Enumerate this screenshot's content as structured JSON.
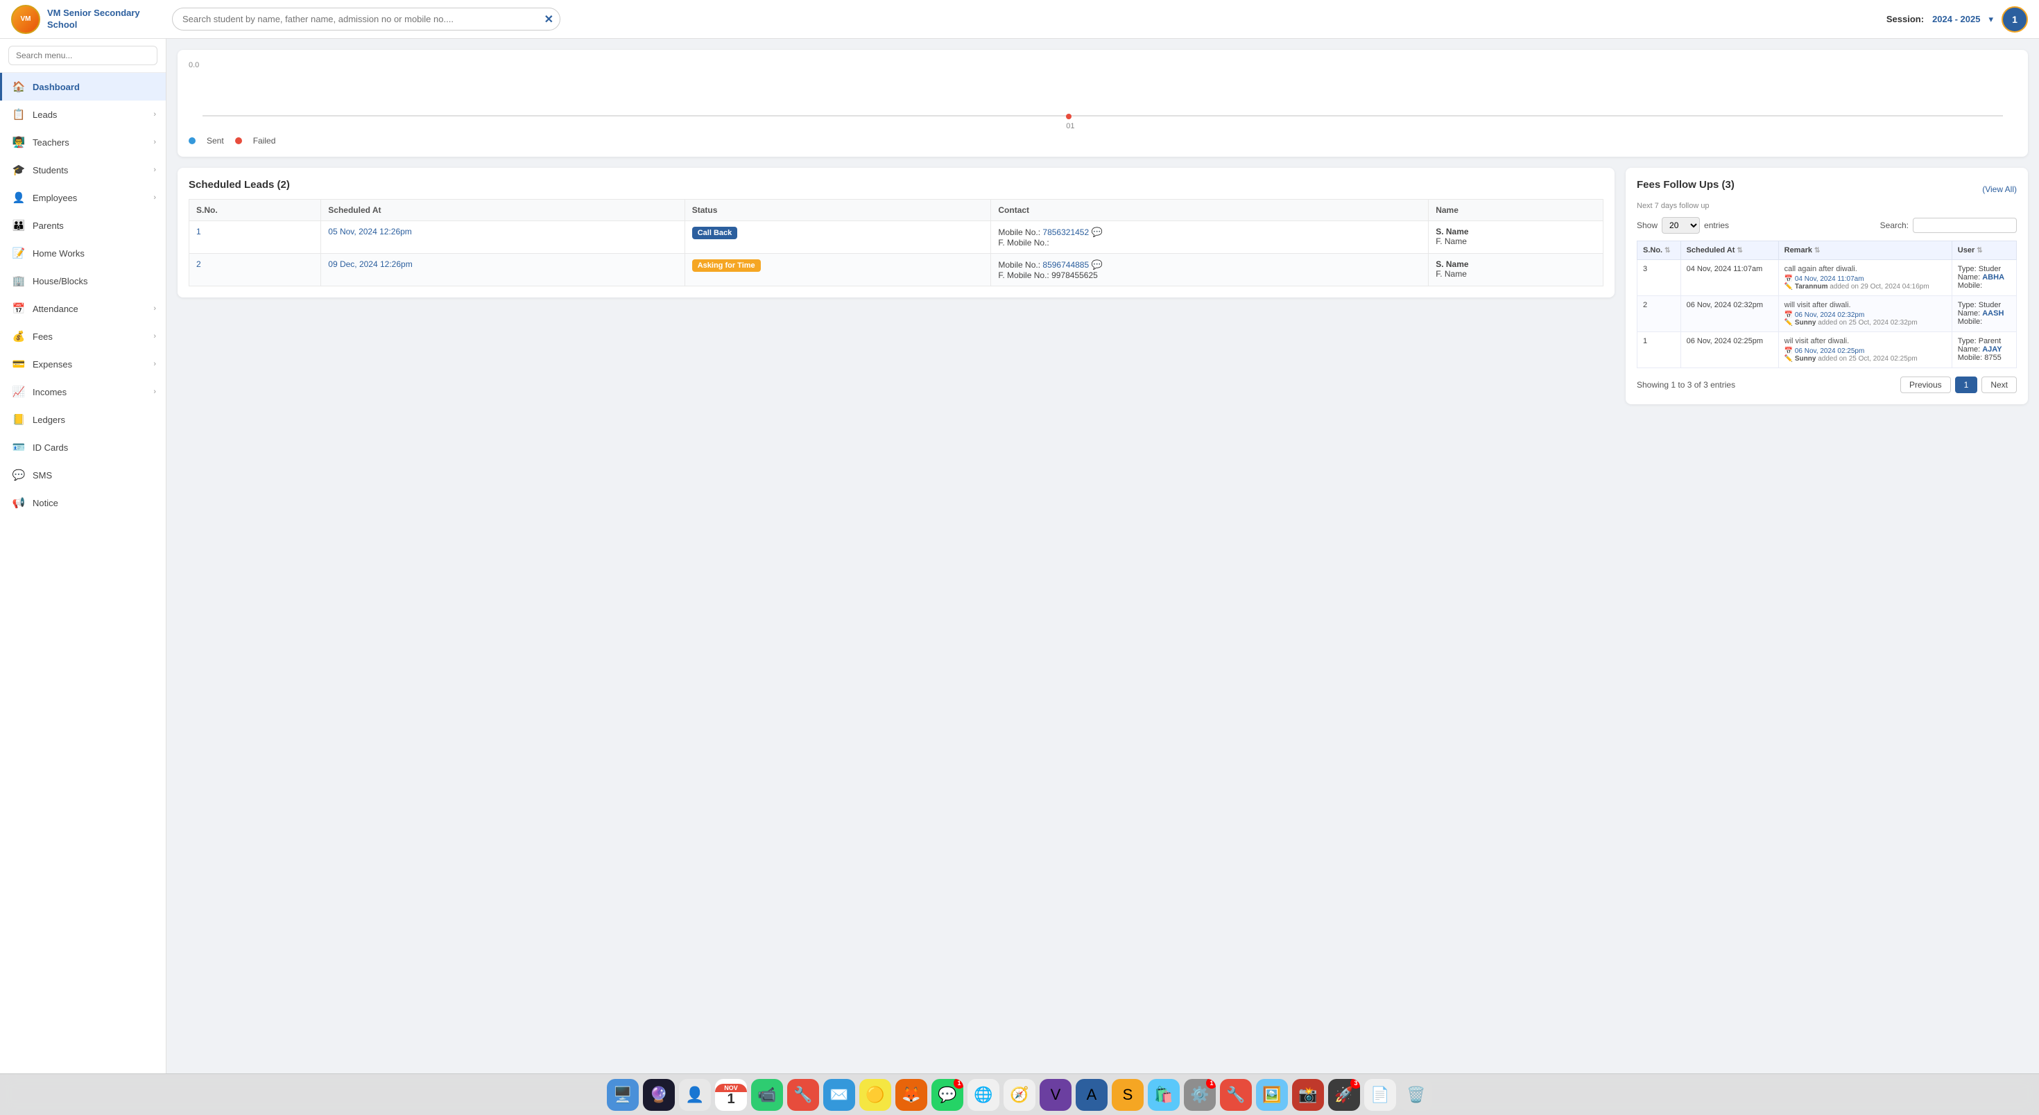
{
  "topbar": {
    "school_name": "VM Senior Secondary\nSchool",
    "search_placeholder": "Search student by name, father name, admission no or mobile no....",
    "session_label": "Session:",
    "session_value": "2024 - 2025",
    "user_initial": "1"
  },
  "sidebar": {
    "search_placeholder": "Search menu...",
    "items": [
      {
        "id": "dashboard",
        "label": "Dashboard",
        "icon": "🏠",
        "active": true,
        "has_arrow": false
      },
      {
        "id": "leads",
        "label": "Leads",
        "icon": "📋",
        "active": false,
        "has_arrow": true
      },
      {
        "id": "teachers",
        "label": "Teachers",
        "icon": "👨‍🏫",
        "active": false,
        "has_arrow": true
      },
      {
        "id": "students",
        "label": "Students",
        "icon": "🎓",
        "active": false,
        "has_arrow": true
      },
      {
        "id": "employees",
        "label": "Employees",
        "icon": "👤",
        "active": false,
        "has_arrow": true
      },
      {
        "id": "parents",
        "label": "Parents",
        "icon": "👪",
        "active": false,
        "has_arrow": false
      },
      {
        "id": "homeworks",
        "label": "Home Works",
        "icon": "📝",
        "active": false,
        "has_arrow": false
      },
      {
        "id": "house-blocks",
        "label": "House/Blocks",
        "icon": "🏢",
        "active": false,
        "has_arrow": false
      },
      {
        "id": "attendance",
        "label": "Attendance",
        "icon": "📅",
        "active": false,
        "has_arrow": true
      },
      {
        "id": "fees",
        "label": "Fees",
        "icon": "💰",
        "active": false,
        "has_arrow": true
      },
      {
        "id": "expenses",
        "label": "Expenses",
        "icon": "💳",
        "active": false,
        "has_arrow": true
      },
      {
        "id": "incomes",
        "label": "Incomes",
        "icon": "📈",
        "active": false,
        "has_arrow": true
      },
      {
        "id": "ledgers",
        "label": "Ledgers",
        "icon": "📒",
        "active": false,
        "has_arrow": false
      },
      {
        "id": "id-cards",
        "label": "ID Cards",
        "icon": "🪪",
        "active": false,
        "has_arrow": false
      },
      {
        "id": "sms",
        "label": "SMS",
        "icon": "💬",
        "active": false,
        "has_arrow": false
      },
      {
        "id": "notice",
        "label": "Notice",
        "icon": "📢",
        "active": false,
        "has_arrow": false
      }
    ]
  },
  "chart": {
    "y_label": "0.0",
    "x_label": "01",
    "legend": [
      {
        "label": "Sent",
        "color": "#3498db"
      },
      {
        "label": "Failed",
        "color": "#e74c3c"
      }
    ]
  },
  "scheduled_leads": {
    "title": "Scheduled Leads (2)",
    "columns": [
      "S.No.",
      "Scheduled At",
      "Status",
      "Contact",
      "Name"
    ],
    "rows": [
      {
        "sno": "1",
        "scheduled_at": "05 Nov, 2024 12:26pm",
        "status": "Call Back",
        "status_type": "callback",
        "mobile": "7856321452",
        "f_mobile": "",
        "name": "S. Name",
        "fname": "F. Name"
      },
      {
        "sno": "2",
        "scheduled_at": "09 Dec, 2024 12:26pm",
        "status": "Asking for Time",
        "status_type": "asking",
        "mobile": "8596744885",
        "f_mobile": "9978455625",
        "name": "S. Name",
        "fname": "F. Name"
      }
    ]
  },
  "fees_followups": {
    "title": "Fees Follow Ups (3)",
    "subtitle": "Next 7 days follow up",
    "view_all_label": "(View All)",
    "show_label": "Show",
    "show_value": "20",
    "entries_label": "entries",
    "search_label": "Search:",
    "columns": [
      "S.No.",
      "Scheduled At",
      "Remark",
      "User"
    ],
    "rows": [
      {
        "sno": "3",
        "scheduled_at": "04 Nov, 2024 11:07am",
        "remark": "call again after diwali.",
        "remark_date": "04 Nov, 2024 11:07am",
        "added_by": "Tarannum",
        "added_on": "29 Oct, 2024 04:16pm",
        "user_type": "Type: Studer",
        "user_name": "ABHA",
        "user_mobile": "Mobile:"
      },
      {
        "sno": "2",
        "scheduled_at": "06 Nov, 2024 02:32pm",
        "remark": "will visit after diwali.",
        "remark_date": "06 Nov, 2024 02:32pm",
        "added_by": "Sunny",
        "added_on": "25 Oct, 2024 02:32pm",
        "user_type": "Type: Studer",
        "user_name": "AASH",
        "user_mobile": "Mobile:"
      },
      {
        "sno": "1",
        "scheduled_at": "06 Nov, 2024 02:25pm",
        "remark": "wil visit after diwali.",
        "remark_date": "06 Nov, 2024 02:25pm",
        "added_by": "Sunny",
        "added_on": "25 Oct, 2024 02:25pm",
        "user_type": "Type: Parent",
        "user_name": "AJAY",
        "user_mobile": "Mobile: 8755"
      }
    ],
    "pagination": {
      "showing_text": "Showing 1 to 3 of 3 entries",
      "previous_label": "Previous",
      "page_num": "1",
      "next_label": "Next"
    }
  },
  "taskbar": {
    "apps": [
      {
        "id": "finder",
        "emoji": "🖥️",
        "bg": "#4a90d9",
        "badge": null
      },
      {
        "id": "siri",
        "emoji": "🔮",
        "bg": "#000",
        "badge": null
      },
      {
        "id": "contacts",
        "emoji": "👤",
        "bg": "#f0f0f0",
        "badge": null
      },
      {
        "id": "calendar",
        "type": "date",
        "month": "NOV",
        "day": "1",
        "badge": null
      },
      {
        "id": "facetime",
        "emoji": "📹",
        "bg": "#2ecc71",
        "badge": null
      },
      {
        "id": "toolbox",
        "emoji": "🔧",
        "bg": "#e74c3c",
        "badge": null
      },
      {
        "id": "mail",
        "emoji": "✉️",
        "bg": "#3498db",
        "badge": null
      },
      {
        "id": "notes",
        "emoji": "🟡",
        "bg": "#f5e642",
        "badge": null
      },
      {
        "id": "firefox",
        "emoji": "🦊",
        "bg": "#ff7300",
        "badge": null
      },
      {
        "id": "whatsapp",
        "emoji": "💬",
        "bg": "#25d366",
        "badge": "1"
      },
      {
        "id": "chrome",
        "emoji": "🌐",
        "bg": "#fff",
        "badge": null
      },
      {
        "id": "safari",
        "emoji": "🧭",
        "bg": "#fff",
        "badge": null
      },
      {
        "id": "vedmarg",
        "emoji": "V",
        "bg": "#6b3fa0",
        "badge": null
      },
      {
        "id": "admin",
        "emoji": "A",
        "bg": "#2c5f9e",
        "badge": null
      },
      {
        "id": "sublime",
        "emoji": "S",
        "bg": "#f5a623",
        "badge": null
      },
      {
        "id": "appstore",
        "emoji": "🛍️",
        "bg": "#3498db",
        "badge": null
      },
      {
        "id": "settings",
        "emoji": "⚙️",
        "bg": "#999",
        "badge": "1"
      },
      {
        "id": "toolbox2",
        "emoji": "🔧",
        "bg": "#e74c3c",
        "badge": null
      },
      {
        "id": "preview",
        "emoji": "🖼️",
        "bg": "#6bc5f8",
        "badge": null
      },
      {
        "id": "photobooth",
        "emoji": "📸",
        "bg": "#e74c3c",
        "badge": null
      },
      {
        "id": "launchpad",
        "emoji": "🚀",
        "bg": "#3c3c3c",
        "badge": "3"
      },
      {
        "id": "texteditor",
        "emoji": "📄",
        "bg": "#f0f0f0",
        "badge": null
      },
      {
        "id": "trash",
        "emoji": "🗑️",
        "bg": "#f0f0f0",
        "badge": null
      }
    ]
  }
}
